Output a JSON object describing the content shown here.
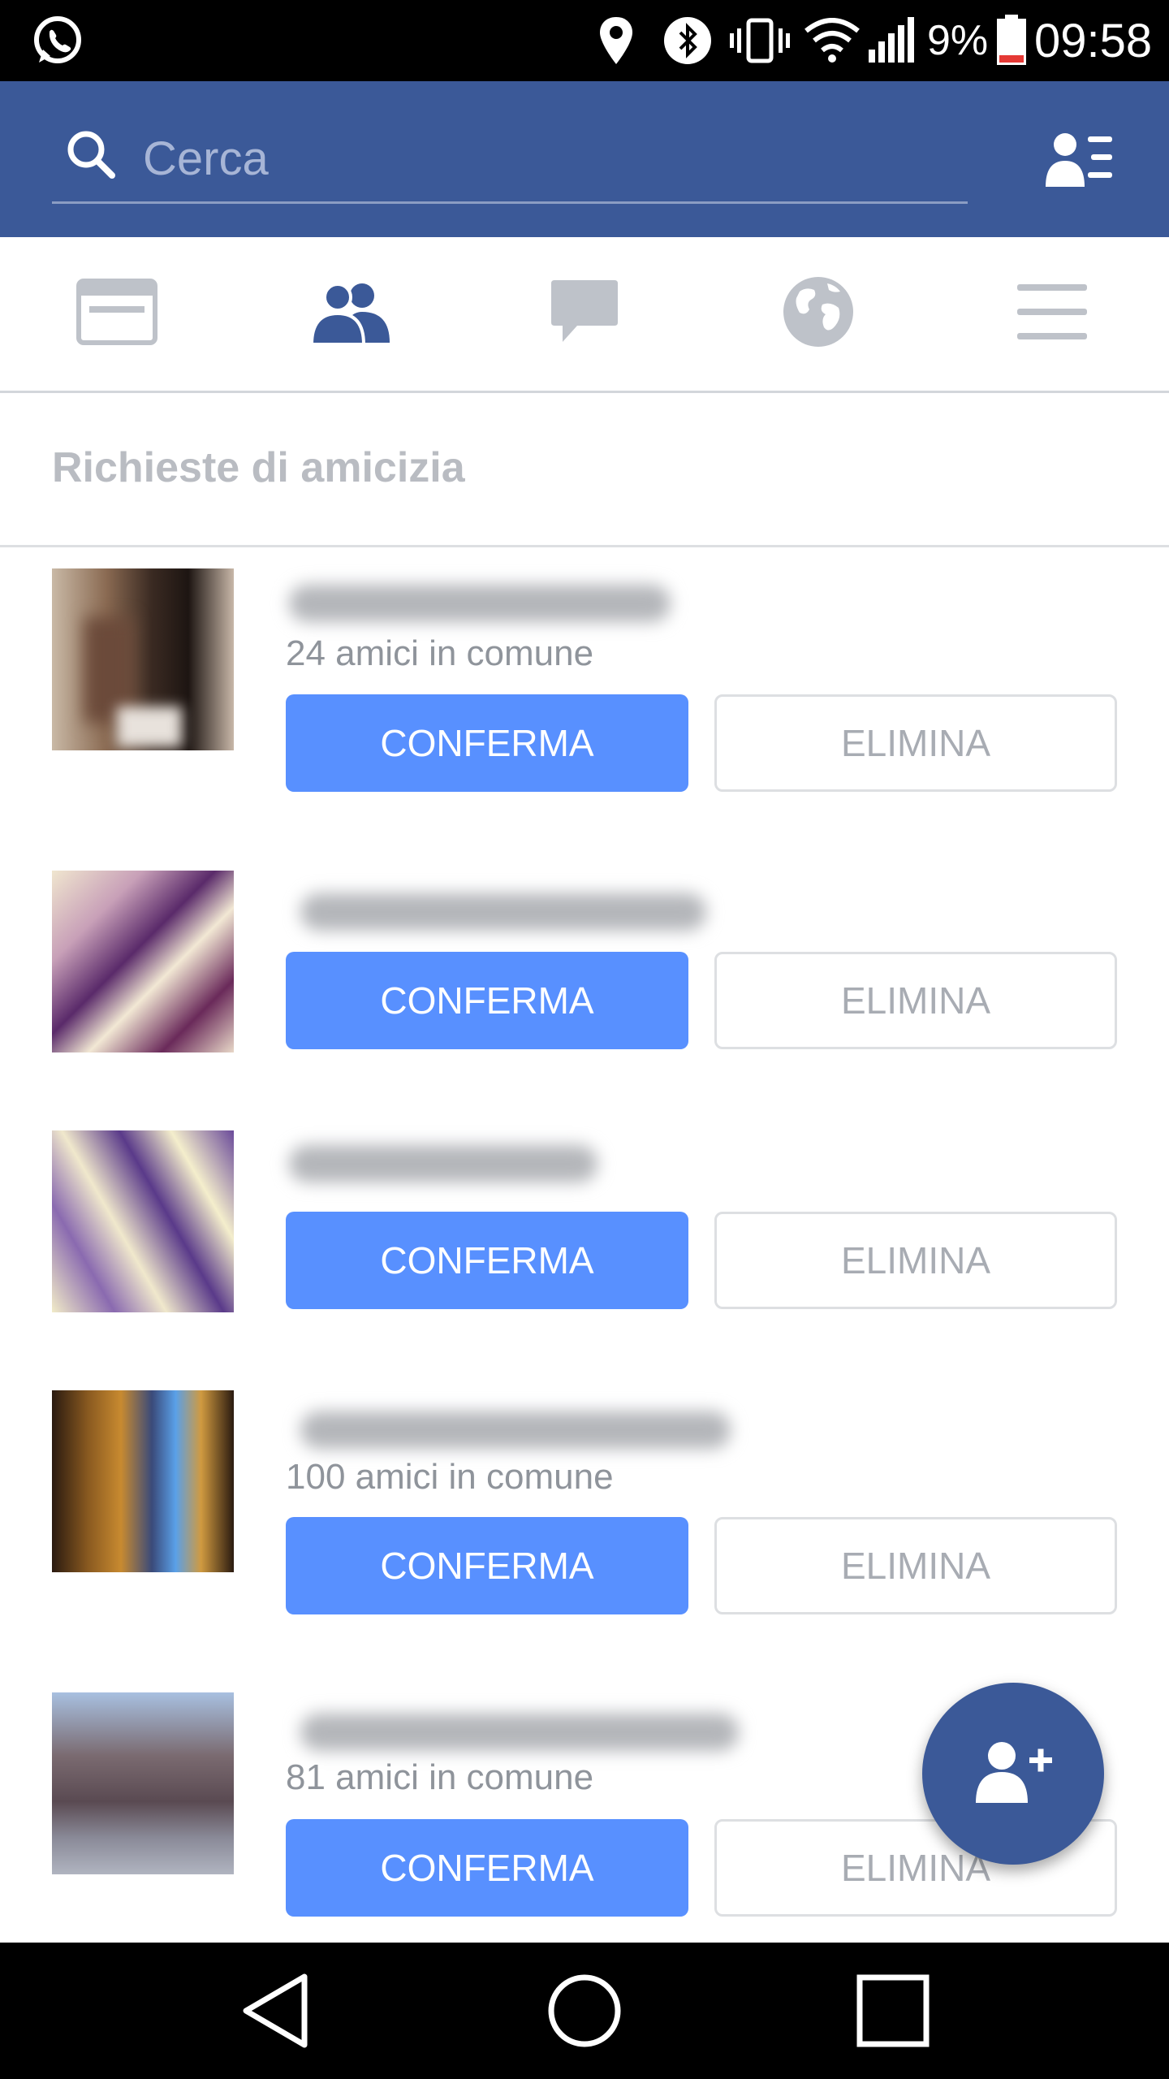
{
  "status_bar": {
    "battery_percent": "9%",
    "time": "09:58",
    "icons": [
      "whatsapp-icon",
      "location-icon",
      "bluetooth-icon",
      "vibrate-icon",
      "wifi-icon",
      "signal-icon",
      "battery-icon"
    ]
  },
  "header": {
    "search_placeholder": "Cerca",
    "icons": [
      "search-icon",
      "friend-list-icon"
    ]
  },
  "tabs": [
    {
      "name": "news-feed",
      "icon": "news-feed-icon",
      "active": false
    },
    {
      "name": "friend-requests",
      "icon": "friends-icon",
      "active": true
    },
    {
      "name": "messages",
      "icon": "chat-bubble-icon",
      "active": false
    },
    {
      "name": "notifications",
      "icon": "globe-icon",
      "active": false
    },
    {
      "name": "menu",
      "icon": "hamburger-menu-icon",
      "active": false
    }
  ],
  "section": {
    "title": "Richieste di amicizia"
  },
  "requests": [
    {
      "mutual_friends": "24 amici in comune",
      "confirm_label": "CONFERMA",
      "delete_label": "ELIMINA"
    },
    {
      "mutual_friends": "",
      "confirm_label": "CONFERMA",
      "delete_label": "ELIMINA"
    },
    {
      "mutual_friends": "",
      "confirm_label": "CONFERMA",
      "delete_label": "ELIMINA"
    },
    {
      "mutual_friends": "100 amici in comune",
      "confirm_label": "CONFERMA",
      "delete_label": "ELIMINA"
    },
    {
      "mutual_friends": "81 amici in comune",
      "confirm_label": "CONFERMA",
      "delete_label": "ELIMINA"
    }
  ],
  "fab": {
    "icon": "add-friend-icon"
  },
  "nav_bar": {
    "icons": [
      "back-icon",
      "home-icon",
      "recents-icon"
    ]
  },
  "colors": {
    "brand": "#3b5998",
    "confirm_button": "#5890ff",
    "muted_text": "#8f949b"
  }
}
